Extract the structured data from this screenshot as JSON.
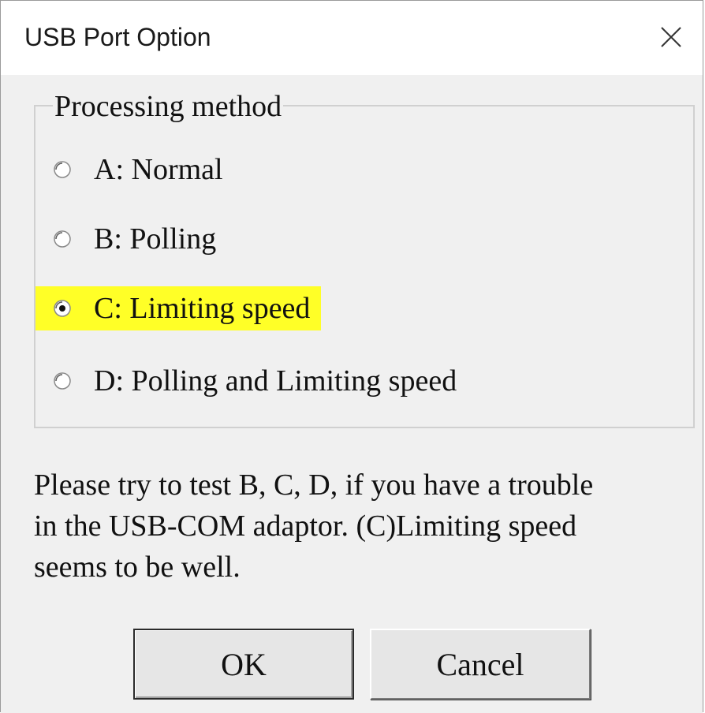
{
  "window": {
    "title": "USB Port Option",
    "close_icon": "close-icon"
  },
  "group": {
    "legend": "Processing method",
    "options": [
      {
        "label": "A: Normal",
        "selected": false
      },
      {
        "label": "B: Polling",
        "selected": false
      },
      {
        "label": "C: Limiting speed",
        "selected": true,
        "highlight_color": "#ffff27"
      },
      {
        "label": "D: Polling and Limiting speed",
        "selected": false
      }
    ]
  },
  "help": {
    "line1": "Please try to test B, C, D, if you have a trouble",
    "line2": "in the USB-COM adaptor. (C)Limiting speed",
    "line3": "seems to be well."
  },
  "buttons": {
    "ok_label": "OK",
    "cancel_label": "Cancel"
  },
  "colors": {
    "highlight": "#ffff27",
    "dialog_bg": "#f0f0f0",
    "titlebar_bg": "#ffffff"
  }
}
